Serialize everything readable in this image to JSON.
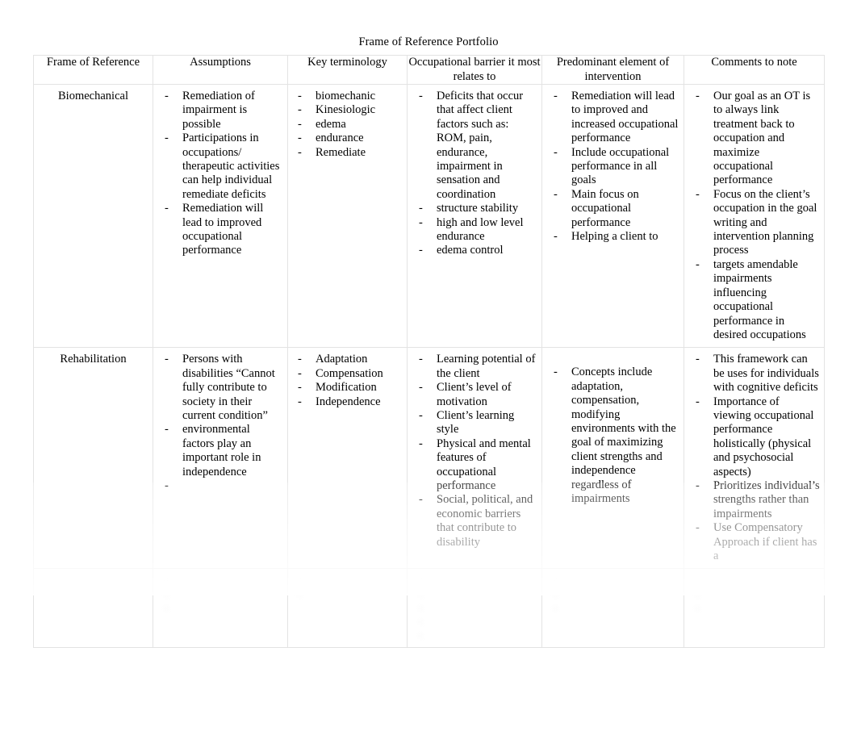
{
  "document": {
    "title": "Frame of Reference Portfolio"
  },
  "table": {
    "headers": [
      "Frame of Reference",
      "Assumptions",
      "Key terminology",
      "Occupational barrier it most relates to",
      "Predominant element of intervention",
      "Comments to note"
    ],
    "rows": [
      {
        "name": "Biomechanical",
        "assumptions": [
          "Remediation of impairment is possible",
          "Participations in occupations/ therapeutic activities can help individual remediate deficits",
          "Remediation will lead to improved occupational performance"
        ],
        "key_terminology": [
          "biomechanic",
          "Kinesiologic",
          "edema",
          "endurance",
          "Remediate"
        ],
        "occupational_barrier": [
          "Deficits that occur that affect client factors such as:",
          "ROM, pain, endurance, impairment in sensation and coordination",
          "structure stability",
          "high and low level endurance",
          "edema control"
        ],
        "occupational_barrier_continuation_index": 1,
        "predominant_element": [
          "Remediation will lead to improved and increased occupational performance",
          "Include occupational performance in all goals",
          "Main focus on occupational performance",
          "Helping a client to"
        ],
        "comments": [
          "Our goal as an OT is to always link treatment back to occupation and maximize occupational performance",
          "Focus on the client’s occupation in the goal writing and intervention planning process",
          "targets amendable impairments influencing occupational performance in desired occupations"
        ]
      },
      {
        "name": "Rehabilitation",
        "assumptions": [
          "Persons with disabilities “Cannot fully contribute to society in their current condition”",
          "environmental factors play an important role in independence",
          ""
        ],
        "key_terminology": [
          "Adaptation",
          "Compensation",
          "Modification",
          "Independence"
        ],
        "occupational_barrier": [
          "Learning potential of the client",
          "Client’s level of motivation",
          "Client’s learning style",
          "Physical and mental features of occupational performance",
          "Social, political, and economic barriers that contribute to disability"
        ],
        "predominant_element": [
          "Concepts include adaptation, compensation, modifying environments with the goal of maximizing client strengths and independence regardless of impairments"
        ],
        "comments": [
          "This framework can be uses for individuals with cognitive deficits",
          "Importance of viewing occupational performance holistically (physical and psychosocial aspects)",
          "Prioritizes individual’s strengths rather than impairments",
          "Use Compensatory Approach if client has a"
        ]
      },
      {
        "name": "",
        "faded": true,
        "assumptions": [
          "",
          "",
          ""
        ],
        "key_terminology": [
          "",
          ""
        ],
        "occupational_barrier": [
          "",
          "",
          "",
          "",
          ""
        ],
        "predominant_element": [
          "",
          "",
          ""
        ],
        "comments": [
          "",
          "",
          ""
        ]
      }
    ]
  }
}
